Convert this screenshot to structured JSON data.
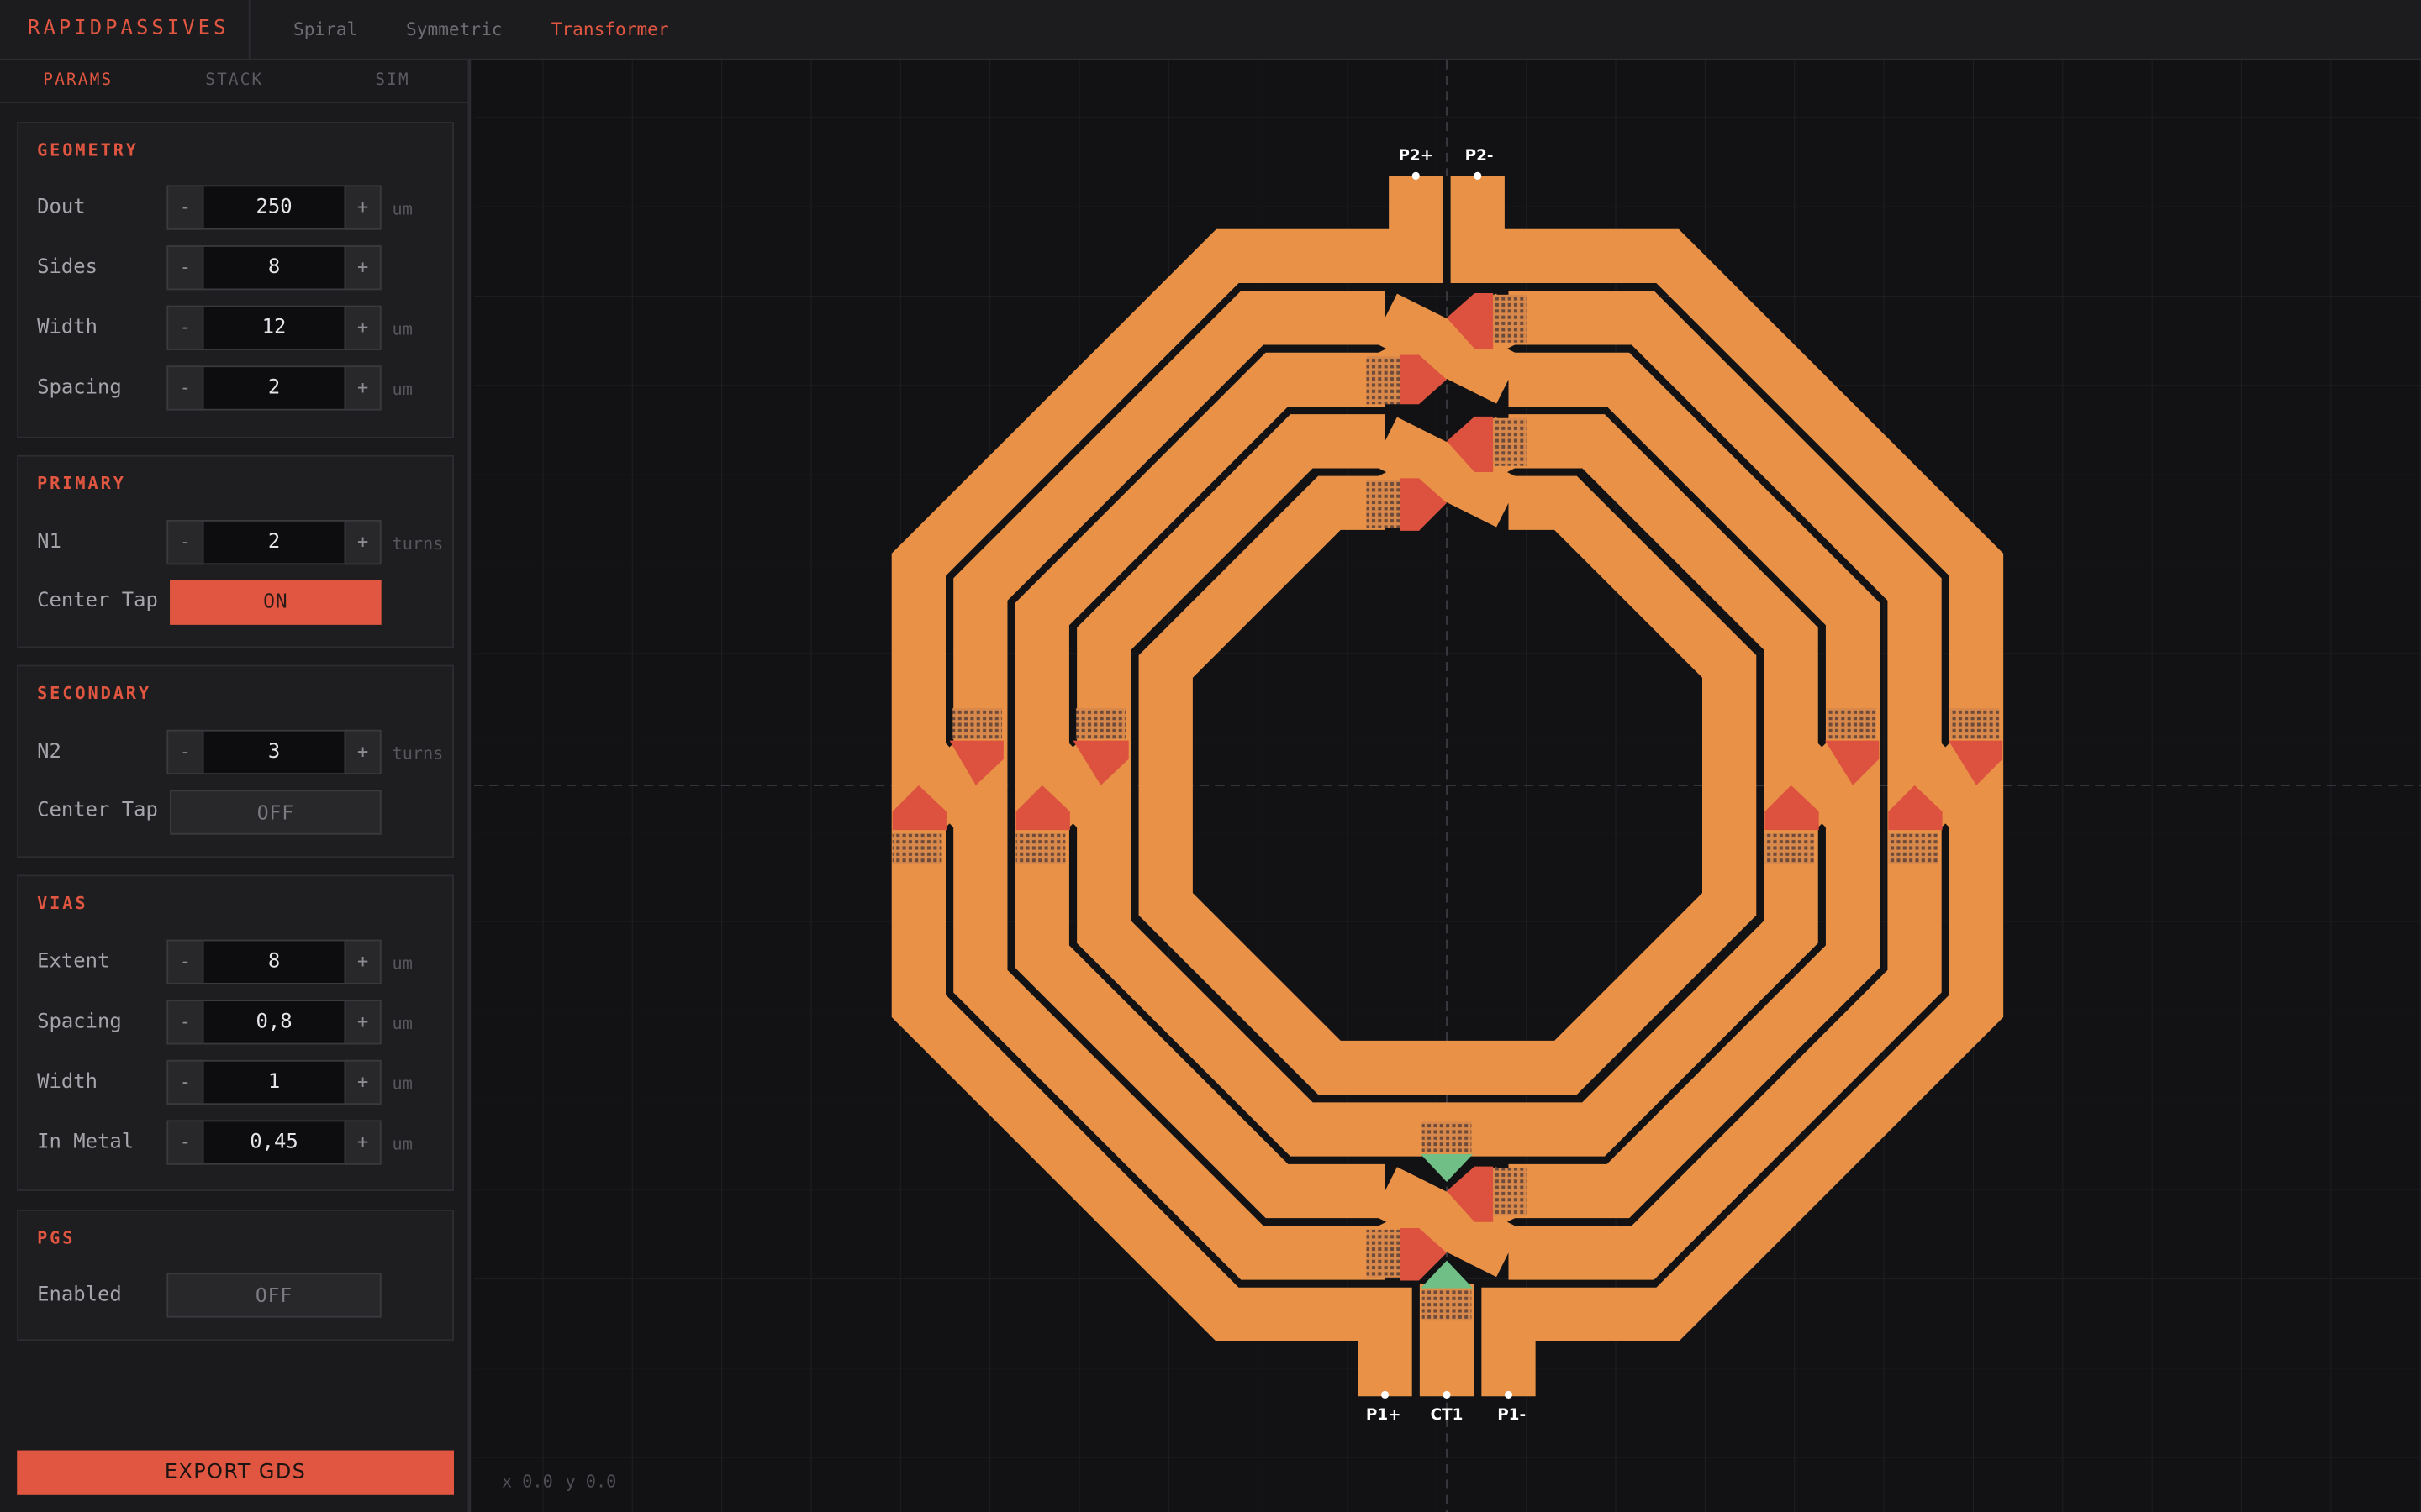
{
  "app": {
    "brand": "RAPIDPASSIVES"
  },
  "mode_tabs": [
    {
      "label": "Spiral",
      "active": false
    },
    {
      "label": "Symmetric",
      "active": false
    },
    {
      "label": "Transformer",
      "active": true
    }
  ],
  "panel_tabs": [
    {
      "label": "PARAMS",
      "active": true
    },
    {
      "label": "STACK",
      "active": false
    },
    {
      "label": "SIM",
      "active": false
    }
  ],
  "stepper_labels": {
    "minus": "-",
    "plus": "+"
  },
  "geometry": {
    "title": "GEOMETRY",
    "dout": {
      "label": "Dout",
      "value": "250",
      "unit": "um"
    },
    "sides": {
      "label": "Sides",
      "value": "8"
    },
    "width": {
      "label": "Width",
      "value": "12",
      "unit": "um"
    },
    "spacing": {
      "label": "Spacing",
      "value": "2",
      "unit": "um"
    }
  },
  "primary": {
    "title": "PRIMARY",
    "n1": {
      "label": "N1",
      "value": "2",
      "unit": "turns"
    },
    "center_tap": {
      "label": "Center Tap",
      "value": "ON"
    }
  },
  "secondary": {
    "title": "SECONDARY",
    "n2": {
      "label": "N2",
      "value": "3",
      "unit": "turns"
    },
    "center_tap": {
      "label": "Center Tap",
      "value": "OFF"
    }
  },
  "vias": {
    "title": "VIAS",
    "extent": {
      "label": "Extent",
      "value": "8",
      "unit": "um"
    },
    "spacing": {
      "label": "Spacing",
      "value": "0,8",
      "unit": "um"
    },
    "width": {
      "label": "Width",
      "value": "1",
      "unit": "um"
    },
    "in_metal": {
      "label": "In Metal",
      "value": "0,45",
      "unit": "um"
    }
  },
  "pgs": {
    "title": "PGS",
    "enabled": {
      "label": "Enabled",
      "value": "OFF"
    }
  },
  "export_label": "EXPORT GDS",
  "canvas": {
    "ports": {
      "p2_plus": "P2+",
      "p2_minus": "P2-",
      "p1_plus": "P1+",
      "ct1": "CT1",
      "p1_minus": "P1-"
    },
    "coords": {
      "x": "x 0.0",
      "y": "y 0.0"
    }
  },
  "colors": {
    "accent": "#e05641",
    "metal": "#e89147",
    "crossover": "#dc523f",
    "ct_via": "#6fbf86",
    "background": "#121214"
  }
}
